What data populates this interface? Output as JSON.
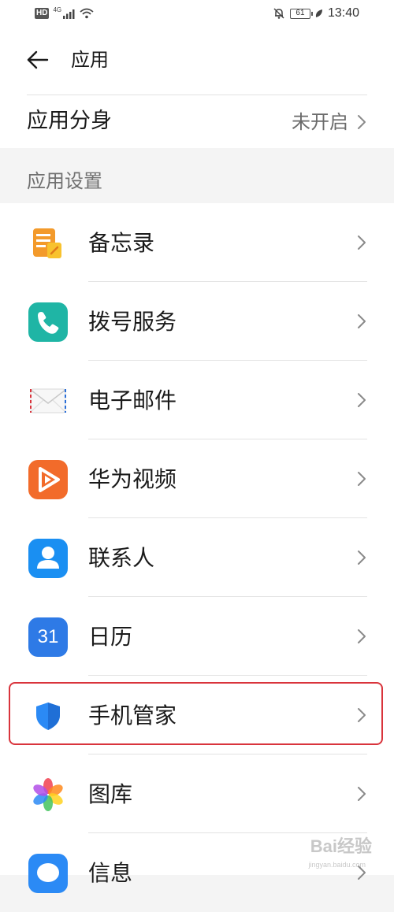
{
  "status_bar": {
    "hd": "HD",
    "network": "4G",
    "battery": "61",
    "time": "13:40",
    "icons": [
      "signal-icon",
      "wifi-icon",
      "mute-bell-icon",
      "battery-icon",
      "leaf-icon"
    ]
  },
  "header": {
    "title": "应用",
    "back_icon": "back-arrow-icon"
  },
  "app_twin": {
    "label": "应用分身",
    "value": "未开启",
    "chevron_icon": "chevron-right-icon"
  },
  "section": {
    "title": "应用设置"
  },
  "apps": [
    {
      "label": "备忘录",
      "icon": "notepad-icon"
    },
    {
      "label": "拨号服务",
      "icon": "phone-icon"
    },
    {
      "label": "电子邮件",
      "icon": "mail-icon"
    },
    {
      "label": "华为视频",
      "icon": "video-play-icon"
    },
    {
      "label": "联系人",
      "icon": "contacts-icon"
    },
    {
      "label": "日历",
      "icon": "calendar-icon",
      "icon_text": "31"
    },
    {
      "label": "手机管家",
      "icon": "shield-icon",
      "highlighted": true
    },
    {
      "label": "图库",
      "icon": "gallery-flower-icon"
    },
    {
      "label": "信息",
      "icon": "messages-icon"
    }
  ],
  "colors": {
    "highlight_border": "#d9343c",
    "notepad": "#f39a2b",
    "phone": "#1fb5a5",
    "video": "#f26b2a",
    "contacts": "#1a8ff2",
    "calendar": "#2e7ae6",
    "shield": "#2b8af5",
    "messages": "#2b8af5"
  },
  "watermark": {
    "text": "Bai经验",
    "sub": "jingyan.baidu.com"
  }
}
